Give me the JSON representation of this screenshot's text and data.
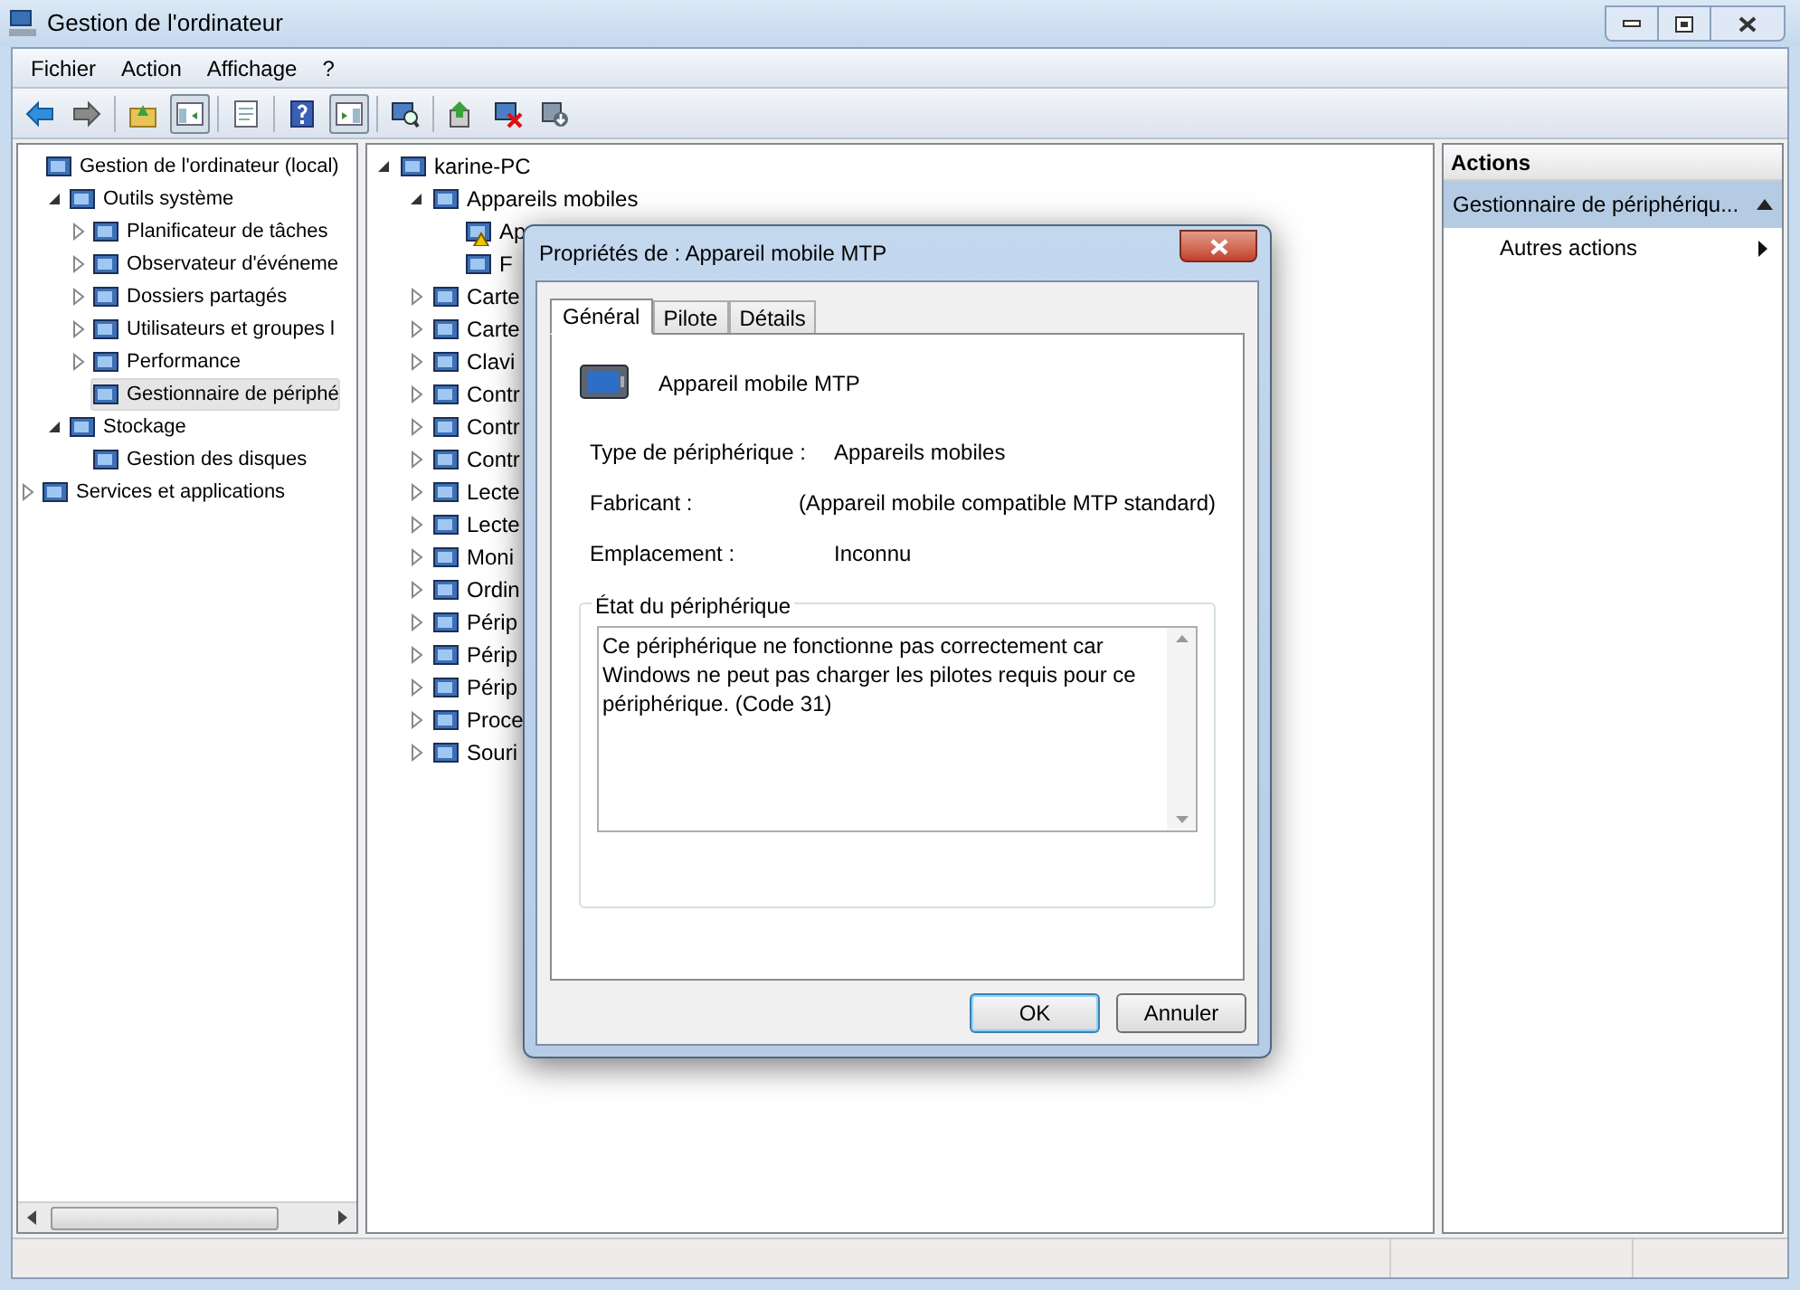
{
  "window": {
    "title": "Gestion de l'ordinateur"
  },
  "menu": [
    "Fichier",
    "Action",
    "Affichage",
    "?"
  ],
  "toolbar_toggles": {
    "console_tree": true,
    "action_pane": true
  },
  "left_tree": [
    {
      "label": "Gestion de l'ordinateur (local)",
      "selected": false,
      "children": [
        {
          "label": "Outils système",
          "expanded": true,
          "selected": false,
          "children": [
            {
              "label": "Planificateur de tâches",
              "expanded": false,
              "selected": false
            },
            {
              "label": "Observateur d'événeme",
              "expanded": false,
              "selected": false
            },
            {
              "label": "Dossiers partagés",
              "expanded": false,
              "selected": false
            },
            {
              "label": "Utilisateurs et groupes l",
              "expanded": false,
              "selected": false
            },
            {
              "label": "Performance",
              "expanded": false,
              "selected": false
            },
            {
              "label": "Gestionnaire de périphé",
              "selected": true
            }
          ]
        },
        {
          "label": "Stockage",
          "expanded": true,
          "selected": false,
          "children": [
            {
              "label": "Gestion des disques",
              "selected": false
            }
          ]
        }
      ]
    },
    {
      "label": "Services et applications",
      "expanded": false,
      "selected": false,
      "outdent": true
    }
  ],
  "middle_tree": [
    {
      "label": "karine-PC",
      "expanded": true,
      "children": [
        {
          "label": "Appareils mobiles",
          "expanded": true,
          "children": [
            {
              "label": "Ap",
              "warning": true
            },
            {
              "label": "F",
              "warning": false
            }
          ]
        },
        {
          "label": "Carte",
          "expanded": false
        },
        {
          "label": "Carte",
          "expanded": false
        },
        {
          "label": "Clavi",
          "expanded": false
        },
        {
          "label": "Contr",
          "expanded": false
        },
        {
          "label": "Contr",
          "expanded": false
        },
        {
          "label": "Contr",
          "expanded": false
        },
        {
          "label": "Lecte",
          "expanded": false
        },
        {
          "label": "Lecte",
          "expanded": false
        },
        {
          "label": "Moni",
          "expanded": false
        },
        {
          "label": "Ordin",
          "expanded": false
        },
        {
          "label": "Périp",
          "expanded": false
        },
        {
          "label": "Périp",
          "expanded": false
        },
        {
          "label": "Périp",
          "expanded": false
        },
        {
          "label": "Proce",
          "expanded": false
        },
        {
          "label": "Souri",
          "expanded": false
        }
      ]
    }
  ],
  "actions_pane": {
    "title": "Actions",
    "section": {
      "label": "Gestionnaire de périphériqu...",
      "expanded": true
    },
    "items": [
      "Autres actions"
    ]
  },
  "dialog": {
    "title": "Propriétés de : Appareil mobile MTP",
    "tabs": [
      {
        "label": "Général",
        "selected": true
      },
      {
        "label": "Pilote",
        "selected": false
      },
      {
        "label": "Détails",
        "selected": false
      }
    ],
    "device_name": "Appareil mobile MTP",
    "properties": [
      {
        "label": "Type de périphérique :",
        "value": "Appareils mobiles"
      },
      {
        "label": "Fabricant :",
        "value": "(Appareil mobile compatible MTP standard)"
      },
      {
        "label": "Emplacement :",
        "value": "Inconnu"
      }
    ],
    "status_group": "État du périphérique",
    "status_text": "Ce périphérique ne fonctionne pas correctement car Windows ne peut pas charger les pilotes requis pour ce périphérique. (Code 31)",
    "buttons": [
      {
        "label": "OK",
        "default": true
      },
      {
        "label": "Annuler",
        "default": false
      }
    ]
  }
}
